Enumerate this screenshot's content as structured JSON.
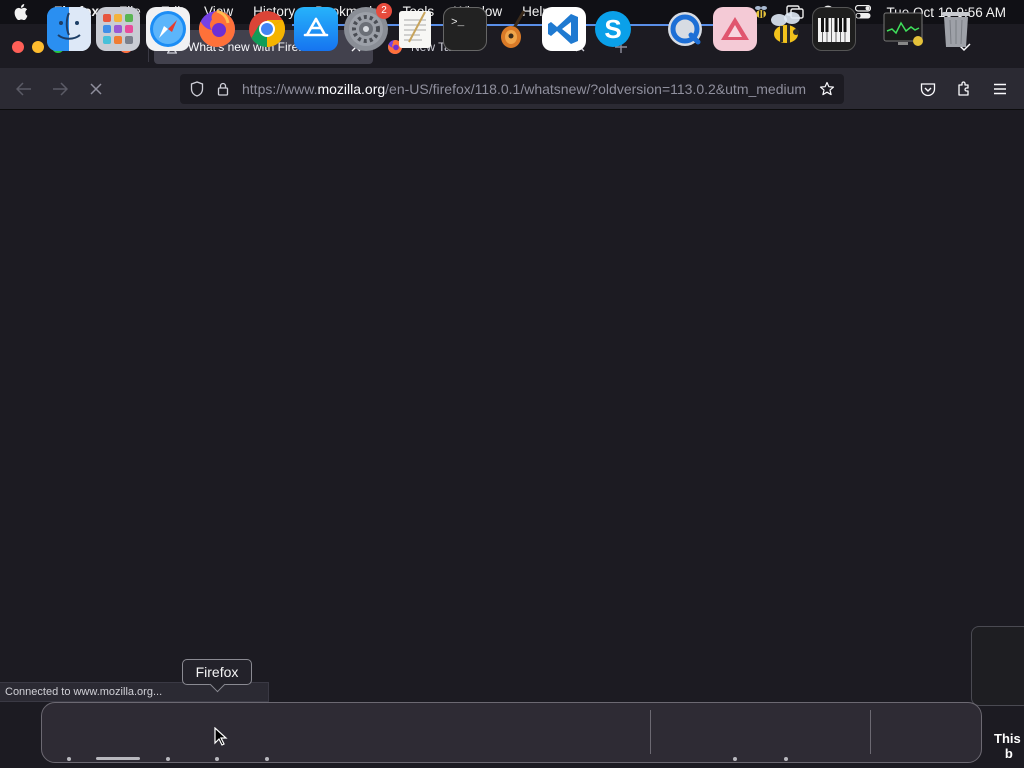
{
  "menubar": {
    "apple_icon": "apple-icon",
    "items": [
      "Firefox",
      "File",
      "Edit",
      "View",
      "History",
      "Bookmarks",
      "Tools",
      "Window",
      "Help"
    ],
    "status_icons": [
      "bee-status-icon",
      "screen-mirroring-icon",
      "spotlight-search-icon",
      "control-center-icon"
    ],
    "clock": "Tue Oct 10  9:56 AM"
  },
  "tabs": {
    "pinned_icon": "firefox-icon",
    "active": {
      "label": "What's new with Firefox",
      "icon": "hourglass-icon",
      "close_icon": "close-icon"
    },
    "inactive": {
      "label": "New Tab",
      "icon": "firefox-icon",
      "close_icon": "close-icon"
    },
    "new_tab_icon": "plus-icon",
    "list_all_tabs_icon": "chevron-down-icon"
  },
  "navbar": {
    "url_prefix": "https://www.",
    "url_host": "mozilla.org",
    "url_path": "/en-US/firefox/118.0.1/whatsnew/?oldversion=113.0.2&utm_medium",
    "buttons": [
      "back-arrow-icon",
      "forward-arrow-icon",
      "stop-icon"
    ],
    "right_icons": [
      "pocket-icon",
      "extensions-icon",
      "hamburger-menu-icon"
    ]
  },
  "status": {
    "text": "Connected to www.mozilla.org..."
  },
  "peek_text": "This\nb",
  "dock": {
    "tooltip": "Firefox",
    "apps": [
      {
        "name": "Finder",
        "icon": "finder-icon",
        "running": true
      },
      {
        "name": "Launchpad",
        "icon": "launchpad-icon",
        "running": false
      },
      {
        "name": "Safari",
        "icon": "safari-icon",
        "running": true
      },
      {
        "name": "Firefox",
        "icon": "firefox-icon",
        "running": true
      },
      {
        "name": "Google Chrome",
        "icon": "chrome-icon",
        "running": true
      },
      {
        "name": "App Store",
        "icon": "app-store-icon",
        "running": false
      },
      {
        "name": "System Settings",
        "icon": "system-settings-icon",
        "running": false,
        "badge": "2"
      },
      {
        "name": "TextEdit",
        "icon": "textedit-icon",
        "running": false
      },
      {
        "name": "Terminal",
        "icon": "terminal-icon",
        "running": false
      },
      {
        "name": "GarageBand",
        "icon": "garageband-icon",
        "running": false
      },
      {
        "name": "Visual Studio Code",
        "icon": "vscode-icon",
        "running": false
      },
      {
        "name": "Skype",
        "icon": "skype-icon",
        "running": false
      },
      {
        "name": "QuickTime Player",
        "icon": "quicktime-icon",
        "running": false
      },
      {
        "name": "Affinity",
        "icon": "pink-triangle-app-icon",
        "running": true
      },
      {
        "name": "Bee app",
        "icon": "bee-app-icon",
        "running": true
      },
      {
        "name": "Piano app",
        "icon": "piano-icon",
        "running": false
      },
      {
        "name": "Activity Monitor",
        "icon": "activity-monitor-icon",
        "running": false
      },
      {
        "name": "Trash",
        "icon": "trash-icon",
        "running": false
      }
    ]
  },
  "colors": {
    "menubar_bg": "#101015",
    "chrome_bg": "#1c1b22",
    "toolbar_bg": "#2b2a33",
    "active_tab_bg": "#42414d",
    "progress_blue": "#5a8fe8"
  }
}
